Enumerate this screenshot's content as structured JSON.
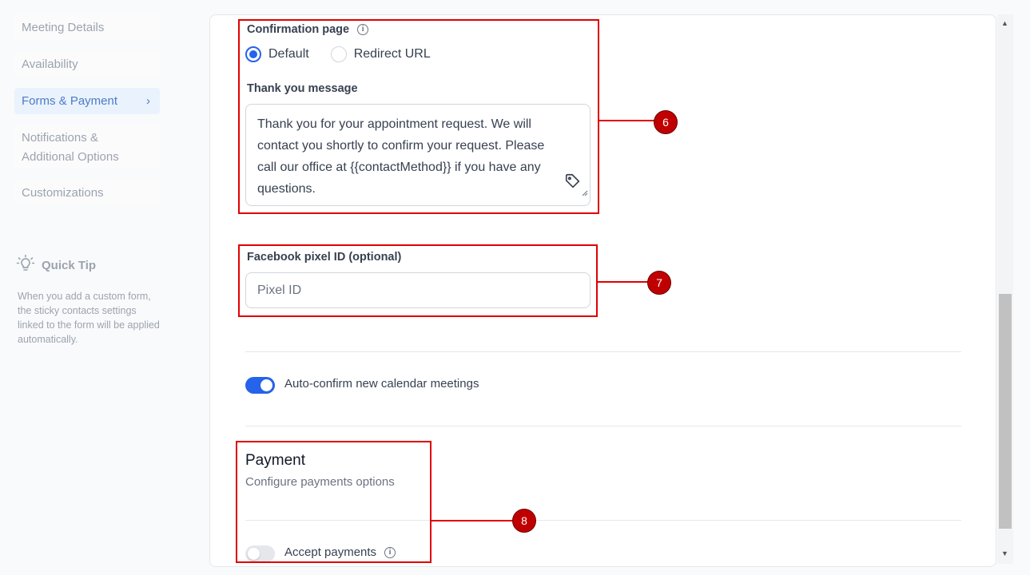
{
  "sidebar": {
    "items": [
      {
        "label": "Meeting Details"
      },
      {
        "label": "Availability"
      },
      {
        "label": "Forms & Payment",
        "chevron": "›"
      },
      {
        "label_line1": "Notifications &",
        "label_line2": "Additional Options"
      },
      {
        "label": "Customizations"
      }
    ],
    "tip": {
      "title": "Quick Tip",
      "text": "When you add a custom form, the sticky contacts settings linked to the form will be applied automatically."
    }
  },
  "confirmation": {
    "label": "Confirmation page",
    "options": [
      {
        "label": "Default",
        "selected": true
      },
      {
        "label": "Redirect URL",
        "selected": false
      }
    ],
    "thank_you_label": "Thank you message",
    "thank_you_message": "Thank you for your appointment request. We will contact you shortly to confirm your request. Please call our office at {{contactMethod}} if you have any questions."
  },
  "pixel": {
    "label": "Facebook pixel ID (optional)",
    "placeholder": "Pixel ID",
    "value": ""
  },
  "auto_confirm": {
    "label": "Auto-confirm new calendar meetings",
    "enabled": true
  },
  "payment": {
    "title": "Payment",
    "subtitle": "Configure payments options",
    "accept_label": "Accept payments",
    "accept_enabled": false
  },
  "annotations": [
    {
      "number": "6"
    },
    {
      "number": "7"
    },
    {
      "number": "8"
    }
  ],
  "colors": {
    "accent": "#2563eb",
    "annotation": "#e00000",
    "active_nav_bg": "#eaf2fd"
  },
  "icons": {
    "tip": "lightbulb-icon",
    "info": "info-icon",
    "tag": "tag-icon",
    "chevron": "chevron-right-icon"
  }
}
